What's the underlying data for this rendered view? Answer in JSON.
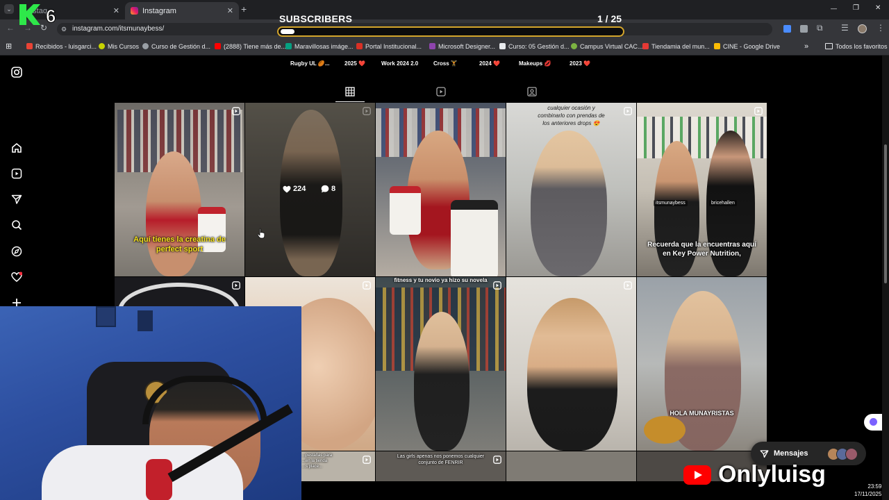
{
  "browser": {
    "tabs": [
      {
        "label": "...staq"
      },
      {
        "label": "Instagram"
      }
    ],
    "new_tab_glyph": "+",
    "url": "instagram.com/itsmunaybess/",
    "window_controls": [
      "—",
      "❐",
      "✕"
    ],
    "bookmarks": [
      {
        "label": "Recibidos - luisgarci...",
        "color": "#ea4335"
      },
      {
        "label": "Mis Cursos",
        "color": "#c8d400"
      },
      {
        "label": "Curso de Gestión d...",
        "color": "#9aa0a6"
      },
      {
        "label": "(2888) Tiene más de...",
        "color": "#ff0000"
      },
      {
        "label": "Maravillosas imáge...",
        "color": "#05a081"
      },
      {
        "label": "Portal Institucional...",
        "color": "#d93025"
      },
      {
        "label": "Microsoft Designer...",
        "color": "#8e44ad"
      },
      {
        "label": "Curso: 05 Gestión d...",
        "color": "#e8eaed"
      },
      {
        "label": "Campus Virtual CAC...",
        "color": "#7cb342"
      },
      {
        "label": "Tiendamia del mun...",
        "color": "#e53935"
      },
      {
        "label": "CINE - Google Drive",
        "color": "#fbbc04"
      }
    ],
    "bookmarks_more": "»",
    "all_bookmarks": "Todos los favoritos"
  },
  "overlay": {
    "subscribers_title": "SUBSCRIBERS",
    "subscribers_count": "1 / 25",
    "subscribers_progress": 0.04,
    "logo_text": "6",
    "brand_text": "Onlyluisg",
    "clock_time": "23:59",
    "clock_date": "17/11/2025"
  },
  "instagram": {
    "highlights": [
      "Rugby UL 🏉...",
      "2025 ❤️",
      "Work 2024 2.0",
      "Cross 🏋️",
      "2024 ❤️",
      "Makeups 💋",
      "2023 ❤️"
    ],
    "sidebar_icons": [
      "instagram-logo-icon",
      "home-icon",
      "reels-icon",
      "send-icon",
      "search-icon",
      "explore-icon",
      "heart-icon",
      "create-icon"
    ],
    "profile_tabs": [
      "grid-icon",
      "reels-icon",
      "tagged-icon"
    ],
    "posts": [
      {
        "caption": "Aquí tienes la creatina de perfect sport"
      },
      {
        "likes": "224",
        "comments": "8"
      },
      {
        "caption": ""
      },
      {
        "caption": "cualquier ocasión y combinarlo con prendas de los anteriores drops 😍"
      },
      {
        "caption": "Recuerda que la encuentras aquí en Key Power Nutrition,",
        "tag1": "itsmunaybess",
        "tag2": "bricehallen"
      },
      {
        "caption": ""
      },
      {
        "caption": ""
      },
      {
        "caption": "fitness y tu novio ya hizo su novela"
      },
      {
        "caption": ""
      },
      {
        "caption": "HOLA MUNAYRISTAS"
      },
      {
        "caption": "...pestañas para ...en la tienda ...s place..."
      },
      {
        "caption": "Las girls apenas nos ponemos cualquier conjunto de FENRIR"
      }
    ],
    "messages_label": "Mensajes"
  }
}
